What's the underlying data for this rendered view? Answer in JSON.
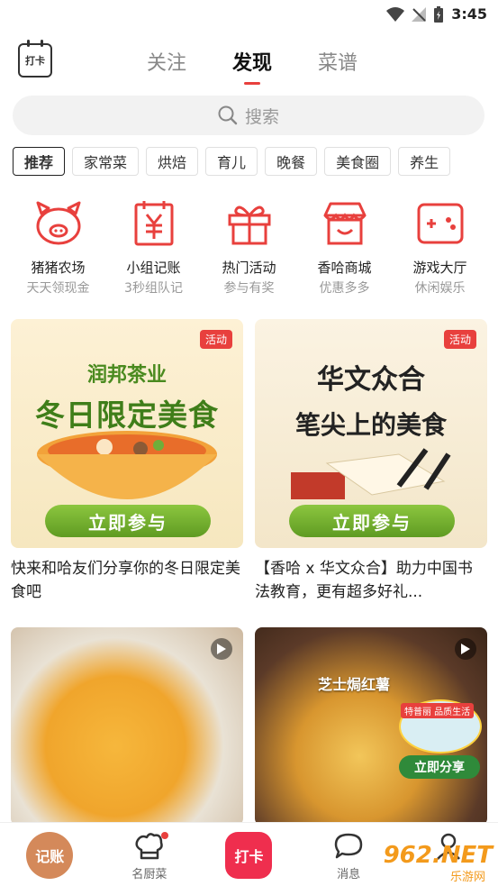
{
  "status": {
    "time": "3:45"
  },
  "header": {
    "checkin_label": "打卡",
    "tabs": [
      {
        "label": "关注"
      },
      {
        "label": "发现"
      },
      {
        "label": "菜谱"
      }
    ]
  },
  "search": {
    "placeholder": "搜索"
  },
  "categories": [
    "推荐",
    "家常菜",
    "烘焙",
    "育儿",
    "晚餐",
    "美食圈",
    "养生"
  ],
  "entries": [
    {
      "title": "猪猪农场",
      "sub": "天天领现金",
      "icon": "pig-icon"
    },
    {
      "title": "小组记账",
      "sub": "3秒组队记",
      "icon": "ledger-icon"
    },
    {
      "title": "热门活动",
      "sub": "参与有奖",
      "icon": "gift-icon"
    },
    {
      "title": "香哈商城",
      "sub": "优惠多多",
      "icon": "store-icon"
    },
    {
      "title": "游戏大厅",
      "sub": "休闲娱乐",
      "icon": "gamepad-icon"
    }
  ],
  "feed": [
    {
      "badge": "活动",
      "brand": "润邦茶业",
      "headline": "冬日限定美食",
      "cta": "立即参与",
      "title": "快来和哈友们分享你的冬日限定美食吧"
    },
    {
      "badge": "活动",
      "brand": "华文众合",
      "headline": "笔尖上的美食",
      "cta": "立即参与",
      "title": "【香哈 x 华文众合】助力中国书法教育，更有超多好礼..."
    },
    {
      "caption": ""
    },
    {
      "caption": "芝士焗红薯",
      "sticker": "特普丽 品质生活",
      "share": "立即分享"
    }
  ],
  "bottom_nav": [
    {
      "label": "记账"
    },
    {
      "label": "名厨菜"
    },
    {
      "label": "打卡"
    },
    {
      "label": "消息"
    },
    {
      "label": ""
    }
  ],
  "watermark": {
    "main": "962.NET",
    "sub": "乐游网"
  },
  "colors": {
    "accent": "#e8403d",
    "green": "#5f9b22",
    "brown": "#d4895a"
  }
}
